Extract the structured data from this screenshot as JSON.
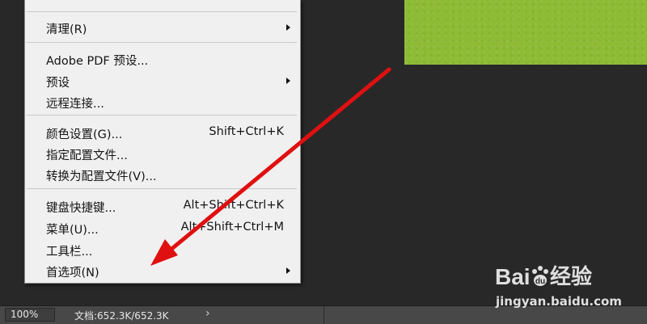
{
  "menu": {
    "items": [
      {
        "label": "清理(R)",
        "shortcut": "",
        "submenu": true
      },
      {
        "label": "Adobe PDF 预设...",
        "shortcut": "",
        "submenu": false
      },
      {
        "label": "预设",
        "shortcut": "",
        "submenu": true
      },
      {
        "label": "远程连接...",
        "shortcut": "",
        "submenu": false
      },
      {
        "label": "颜色设置(G)...",
        "shortcut": "Shift+Ctrl+K",
        "submenu": false
      },
      {
        "label": "指定配置文件...",
        "shortcut": "",
        "submenu": false
      },
      {
        "label": "转换为配置文件(V)...",
        "shortcut": "",
        "submenu": false
      },
      {
        "label": "键盘快捷键...",
        "shortcut": "Alt+Shift+Ctrl+K",
        "submenu": false
      },
      {
        "label": "菜单(U)...",
        "shortcut": "Alt+Shift+Ctrl+M",
        "submenu": false
      },
      {
        "label": "工具栏...",
        "shortcut": "",
        "submenu": false
      },
      {
        "label": "首选项(N)",
        "shortcut": "",
        "submenu": true
      }
    ]
  },
  "statusbar": {
    "zoom": "100%",
    "doc_info": "文档:652.3K/652.3K",
    "expand_glyph": "›"
  },
  "watermark": {
    "logo_text": "Baidu经验",
    "url": "jingyan.baidu.com"
  },
  "colors": {
    "workspace": "#282828",
    "canvas": "#8dbb35",
    "menu_bg": "#f0f0f0",
    "annotation_arrow": "#e01010"
  }
}
